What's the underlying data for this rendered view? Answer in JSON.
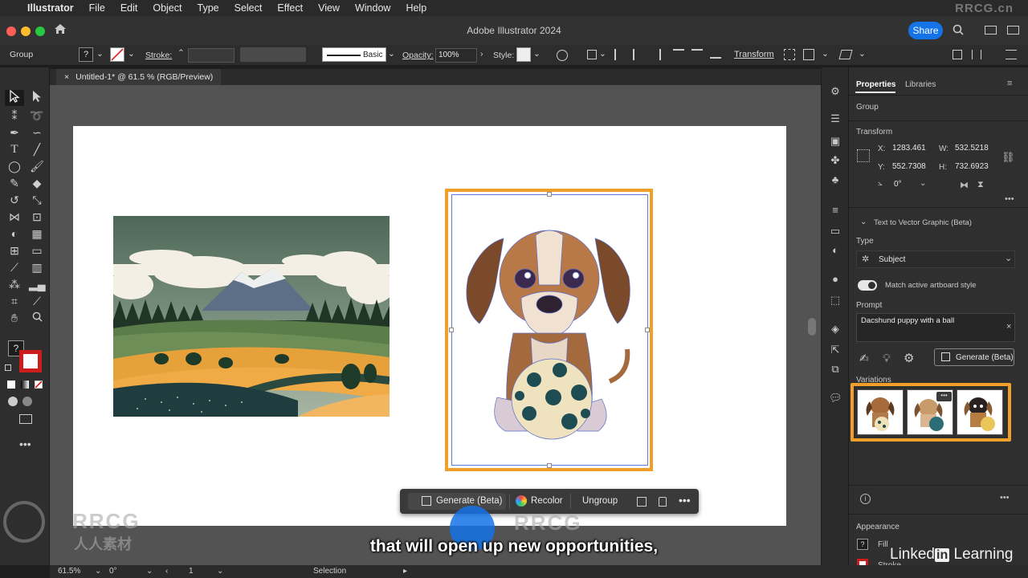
{
  "menubar": {
    "items": [
      "Illustrator",
      "File",
      "Edit",
      "Object",
      "Type",
      "Select",
      "Effect",
      "View",
      "Window",
      "Help"
    ],
    "watermark": "RRCG.cn"
  },
  "titlebar": {
    "title": "Adobe Illustrator 2024",
    "share_label": "Share"
  },
  "controlbar": {
    "selection_type": "Group",
    "stroke_label": "Stroke:",
    "brush_label": "Basic",
    "opacity_label": "Opacity:",
    "opacity_value": "100%",
    "style_label": "Style:",
    "transform_label": "Transform"
  },
  "document": {
    "tab_label": "Untitled-1* @ 61.5 % (RGB/Preview)",
    "close": "×"
  },
  "panel": {
    "tabs": [
      "Properties",
      "Libraries"
    ],
    "selection_type": "Group",
    "transform": {
      "title": "Transform",
      "x_label": "X:",
      "x": "1283.461",
      "y_label": "Y:",
      "y": "552.7308",
      "w_label": "W:",
      "w": "532.5218",
      "h_label": "H:",
      "h": "732.6923",
      "angle": "0°"
    },
    "ttv": {
      "title": "Text to Vector Graphic (Beta)",
      "type_label": "Type",
      "type_value": "Subject",
      "match_style_label": "Match active artboard style",
      "prompt_label": "Prompt",
      "prompt_value": "Dacshund puppy with a ball",
      "generate_label": "Generate (Beta)",
      "variations_label": "Variations"
    },
    "appearance": {
      "title": "Appearance",
      "fill_label": "Fill",
      "stroke_label": "Stroke"
    }
  },
  "taskbar": {
    "generate_label": "Generate (Beta)",
    "recolor_label": "Recolor",
    "ungroup_label": "Ungroup"
  },
  "statusbar": {
    "zoom": "61.5%",
    "rotation": "0°",
    "artboard": "1",
    "tool": "Selection"
  },
  "overlay": {
    "subtitle": "that will open up new opportunities,",
    "linkedin": "Linked",
    "linkedin_in": "in",
    "linkedin_learning": " Learning",
    "watermark_a": "RRCG",
    "watermark_b": "人人素材"
  },
  "colors": {
    "selection_orange": "#f0a028",
    "accent_blue": "#1473e6",
    "artboard": "#ffffff",
    "canvas": "#535353"
  }
}
